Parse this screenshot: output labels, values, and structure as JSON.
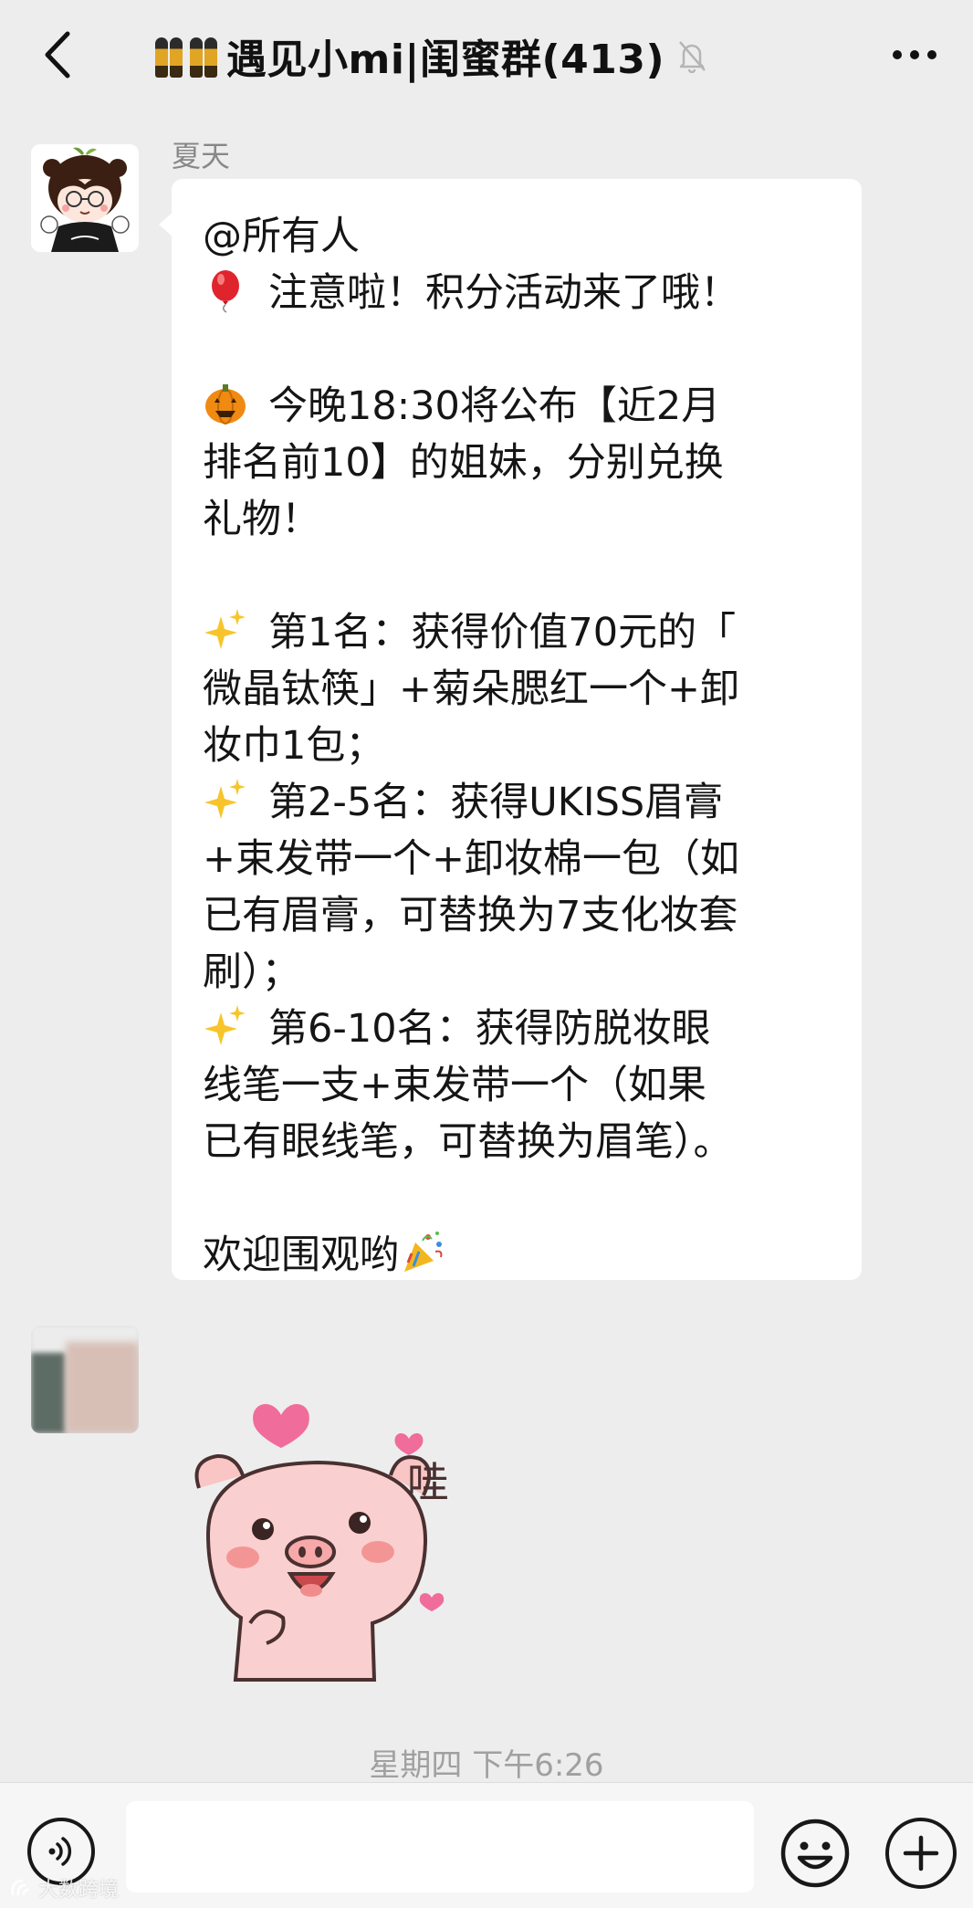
{
  "header": {
    "title": "遇见小mi|闺蜜群(413)",
    "title_emoji_icons": [
      "dancers-icon",
      "dancers-icon"
    ],
    "muted_icon": "bell-muted-icon",
    "back_icon": "chevron-left-icon",
    "more_icon": "more-dots-icon"
  },
  "messages": [
    {
      "sender": "夏天",
      "avatar_icon": "cartoon-boy-avatar",
      "lines": {
        "l1": "@所有人",
        "l2": "注意啦！积分活动来了哦！",
        "l3": "今晚18:30将公布【近2月",
        "l4": "排名前10】的姐妹，分别兑换",
        "l5": "礼物！",
        "l6": "第1名：获得价值70元的「",
        "l7": "微晶钛筷」+菊朵腮红一个+卸",
        "l8": "妆巾1包；",
        "l9": "第2-5名：获得UKISS眉膏",
        "l10": "+束发带一个+卸妆棉一包（如",
        "l11": "已有眉膏，可替换为7支化妆套",
        "l12": "刷）；",
        "l13": "第6-10名：获得防脱妆眼",
        "l14": "线笔一支+束发带一个（如果",
        "l15": "已有眼线笔，可替换为眉笔）。",
        "l16": "欢迎围观哟"
      },
      "icons": [
        "balloon-icon",
        "pumpkin-icon",
        "sparkles-icon",
        "sparkles-icon",
        "sparkles-icon",
        "party-popper-icon"
      ]
    },
    {
      "sender": "",
      "avatar_icon": "blurred-avatar",
      "sticker": {
        "name": "pig-sticker",
        "text": "哇"
      }
    }
  ],
  "timestamp": "星期四 下午6:26",
  "input_bar": {
    "voice_icon": "voice-icon",
    "placeholder": "",
    "emoji_icon": "emoji-icon",
    "plus_icon": "plus-icon"
  },
  "watermark": "大数跨境",
  "colors": {
    "background": "#ededed",
    "bubble": "#ffffff",
    "sticker_pink": "#f6b9bc",
    "heart_pink": "#f06c9b"
  }
}
